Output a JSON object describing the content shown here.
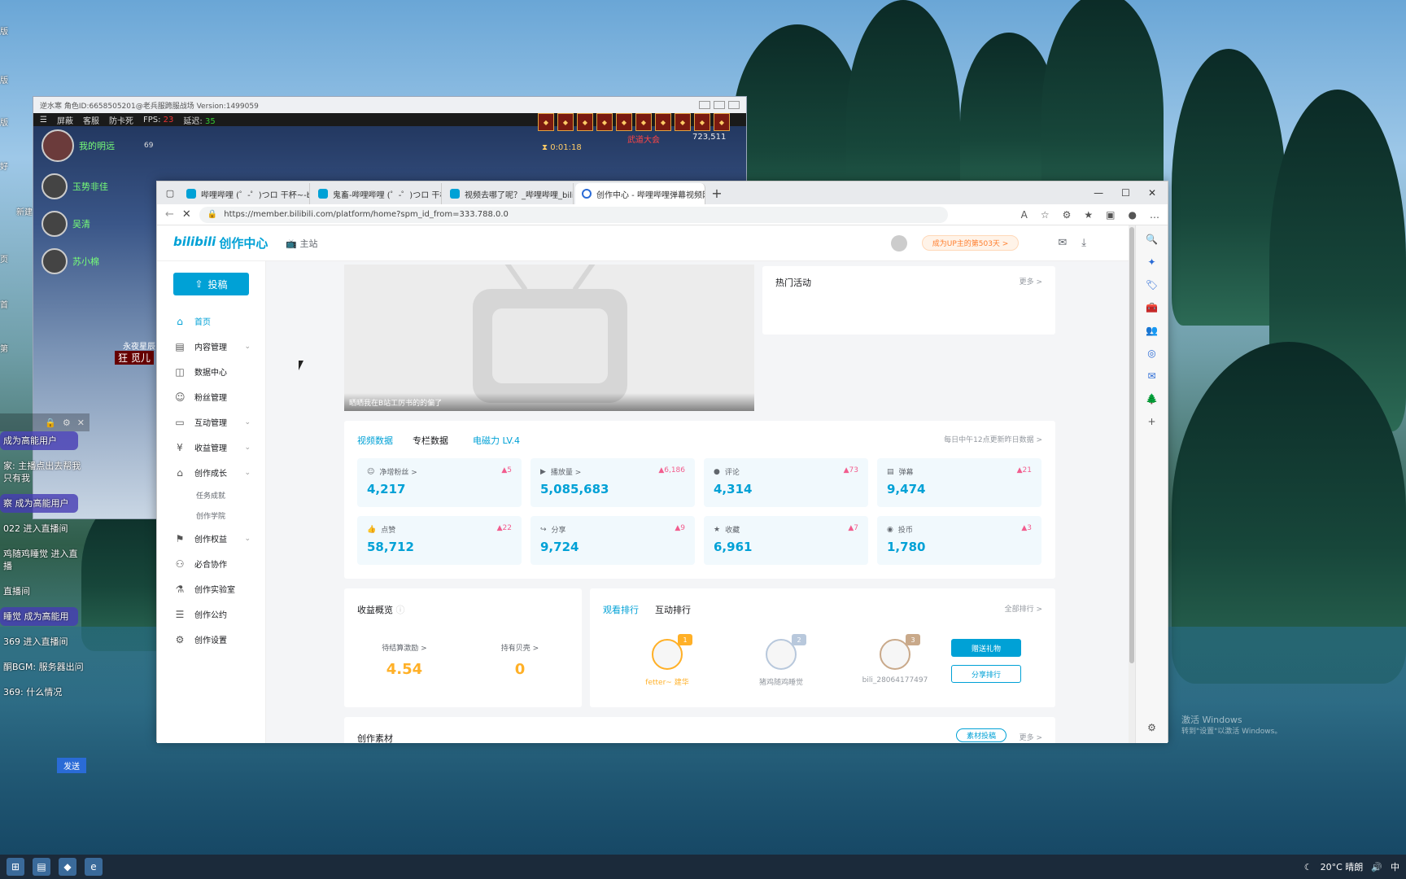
{
  "desktop": {
    "left_labels": [
      "版",
      "版",
      "版",
      "新建",
      "页",
      "首",
      "第",
      "好"
    ],
    "watermark": [
      "激活 Windows",
      "转到\"设置\"以激活 Windows。"
    ]
  },
  "taskbar": {
    "weather": "20°C 晴朗",
    "ime": "中"
  },
  "game": {
    "title": "逆水寒 角色ID:6658505201@老兵服跨服战场 Version:1499059",
    "bar": {
      "items": [
        "屏蔽",
        "客服",
        "防卡死"
      ],
      "fps_label": "FPS:",
      "fps_value": "23",
      "lag_label": "延迟:",
      "lag_value": "35"
    },
    "characters": [
      {
        "name": "我的明远",
        "level": "69"
      },
      {
        "name": "玉势非佳"
      },
      {
        "name": "吴清"
      },
      {
        "name": "苏小棉"
      }
    ],
    "timer": "0:01:18",
    "event": "武道大会",
    "score": "723,511",
    "overhead": "永夜星辰",
    "overhead2": "狂 觅儿"
  },
  "chat": {
    "messages": [
      {
        "text": "成为高能用户",
        "pill": true
      },
      {
        "text": "家: 主播点出去帮我只有我",
        "pill": false
      },
      {
        "text": "察 成为高能用户",
        "pill": true
      },
      {
        "text": "022 进入直播间",
        "pill": false
      },
      {
        "text": "鸡随鸡睡觉 进入直播",
        "pill": false
      },
      {
        "text": "直播间",
        "pill": false
      },
      {
        "text": "睡觉 成为高能用",
        "pill": true
      },
      {
        "text": "369 进入直播间",
        "pill": false
      },
      {
        "text": "酮BGM: 服务器出问",
        "pill": false
      },
      {
        "text": "369: 什么情况",
        "pill": false
      }
    ],
    "send": "发送"
  },
  "browser": {
    "tabs": [
      {
        "title": "哔哩哔哩 (゜-゜)つロ 干杯~-bilibili"
      },
      {
        "title": "鬼畜-哔哩哔哩 (゜-゜)つロ 干杯~"
      },
      {
        "title": "视频去哪了呢？_哔哩哔哩_bilibili"
      },
      {
        "title": "创作中心 - 哔哩哔哩弹幕视频网"
      }
    ],
    "url": "https://member.bilibili.com/platform/home?spm_id_from=333.788.0.0"
  },
  "header": {
    "logo_b": "bilibili",
    "logo_text": "创作中心",
    "home_link": "主站",
    "up_badge": "成为UP主的第503天 >"
  },
  "sidebar": {
    "upload": "投稿",
    "items": [
      {
        "label": "首页",
        "icon": "home-icon",
        "active": true
      },
      {
        "label": "内容管理",
        "icon": "doc-icon",
        "chev": true
      },
      {
        "label": "数据中心",
        "icon": "chart-icon"
      },
      {
        "label": "粉丝管理",
        "icon": "user-icon"
      },
      {
        "label": "互动管理",
        "icon": "chat-icon",
        "chev": true
      },
      {
        "label": "收益管理",
        "icon": "money-icon",
        "chev": true
      },
      {
        "label": "创作成长",
        "icon": "grad-icon",
        "chev": true
      }
    ],
    "sub": [
      "任务成就",
      "创作学院"
    ],
    "items2": [
      {
        "label": "创作权益",
        "icon": "flag-icon",
        "chev": true
      },
      {
        "label": "必合协作",
        "icon": "group-icon"
      },
      {
        "label": "创作实验室",
        "icon": "flask-icon"
      },
      {
        "label": "创作公约",
        "icon": "rule-icon"
      },
      {
        "label": "创作设置",
        "icon": "gear-icon"
      }
    ]
  },
  "banner": {
    "caption": "晒晒我在B站工厉书的的偏了"
  },
  "hot": {
    "title": "热门活动",
    "more": "更多 >"
  },
  "stats": {
    "tabs": [
      "视频数据",
      "专栏数据",
      "电磁力 LV.4"
    ],
    "note": "每日中午12点更新昨日数据 >",
    "cells": [
      {
        "label": "净增粉丝 >",
        "value": "4,217",
        "delta": "▲5",
        "icon": "fans-icon"
      },
      {
        "label": "播放量 >",
        "value": "5,085,683",
        "delta": "▲6,186",
        "icon": "play-icon"
      },
      {
        "label": "评论",
        "value": "4,314",
        "delta": "▲73",
        "icon": "comment-icon"
      },
      {
        "label": "弹幕",
        "value": "9,474",
        "delta": "▲21",
        "icon": "danmaku-icon"
      },
      {
        "label": "点赞",
        "value": "58,712",
        "delta": "▲22",
        "icon": "like-icon"
      },
      {
        "label": "分享",
        "value": "9,724",
        "delta": "▲9",
        "icon": "share-icon"
      },
      {
        "label": "收藏",
        "value": "6,961",
        "delta": "▲7",
        "icon": "star-icon"
      },
      {
        "label": "投币",
        "value": "1,780",
        "delta": "▲3",
        "icon": "coin-icon"
      }
    ]
  },
  "income": {
    "title": "收益概览",
    "items": [
      {
        "label": "待结算激励 >",
        "value": "4.54"
      },
      {
        "label": "持有贝壳 >",
        "value": "0"
      }
    ]
  },
  "rank": {
    "tabs": [
      "观看排行",
      "互动排行"
    ],
    "more": "全部排行 >",
    "users": [
      {
        "rank": "1",
        "name": "fetter~ 建华",
        "color": "#ffb027"
      },
      {
        "rank": "2",
        "name": "猪鸡随鸡睡觉",
        "color": "#b8c8dc"
      },
      {
        "rank": "3",
        "name": "bili_28064177497",
        "color": "#c9a98a"
      }
    ],
    "gift_btn": "赠送礼物",
    "share_btn": "分享排行"
  },
  "material": {
    "title": "创作素材",
    "btn": "素材投稿",
    "more": "更多 >"
  }
}
